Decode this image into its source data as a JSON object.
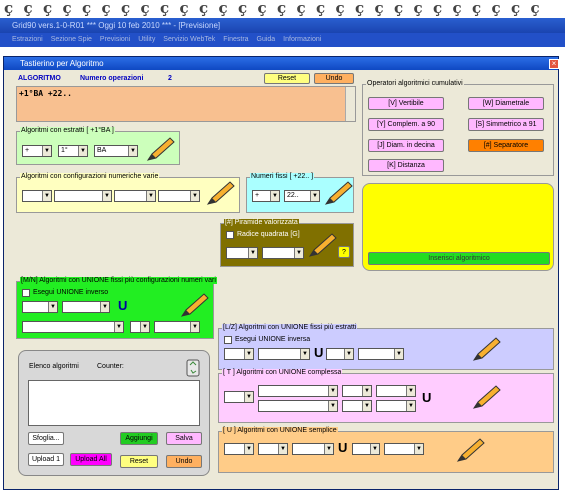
{
  "app": {
    "title": "Grid90 vers.1-0-R01  ***  Oggi 10 feb 2010  ***  - [Previsione]",
    "menu": [
      "Estrazioni",
      "Sezione Spie",
      "Previsioni",
      "Utility",
      "Servizio WebTek",
      "Finestra",
      "Guida",
      "Informazioni"
    ]
  },
  "window": {
    "title": "Tastierino per Algoritmo",
    "close": "×"
  },
  "top": {
    "label": "ALGORITMO",
    "ops_label": "Numero operazioni",
    "ops_count": "2",
    "reset": "Reset",
    "undo": "Undo",
    "expr": "+1°BA +22.."
  },
  "cumul": {
    "title": "Operatori algoritmici cumulativi",
    "buttons": [
      "[V] Vertibile",
      "[W] Diametrale",
      "[Y] Complem. a 90",
      "[S] Simmetrico a 91",
      "[J] Diam. in decina",
      "[#] Separatore",
      "[K] Distanza"
    ]
  },
  "estratti": {
    "title": "Algoritmi con estratti  [ +1°BA ]",
    "c1": "+",
    "c2": "1°",
    "c3": "BA"
  },
  "config": {
    "title": "Algoritmi con configurazioni numeriche varie"
  },
  "fissi": {
    "title": "Numeri fissi  [ +22.. ]",
    "c1": "+",
    "c2": "22.."
  },
  "piramide": {
    "title": "[#] Piramide valorizzata",
    "radice": "Radice quadrata  [G]",
    "q": "?"
  },
  "inserisci": "Inserisci algoritmico",
  "mn": {
    "title": "[M/N] Algoritmi con UNIONE fissi più configurazioni numeri vari",
    "inverso": "Esegui UNIONE inverso",
    "u": "U"
  },
  "lz": {
    "title": "[L/Z] Algoritmi con UNIONE fissi più estratti",
    "inverso": "Esegui UNIONE inversa",
    "u": "U"
  },
  "t": {
    "title": "[ T ] Algoritmi con UNIONE complessa",
    "u": "U"
  },
  "us": {
    "title": "[ U ] Algoritmi con UNIONE semplice",
    "u": "U"
  },
  "elenco": {
    "title": "Elenco algoritmi",
    "counter": "Counter:",
    "sfoglia": "Sfoglia...",
    "aggiungi": "Aggiungi",
    "salva": "Salva",
    "upload1": "Upload 1",
    "uploadall": "Upload All",
    "reset": "Reset",
    "undo": "Undo"
  }
}
